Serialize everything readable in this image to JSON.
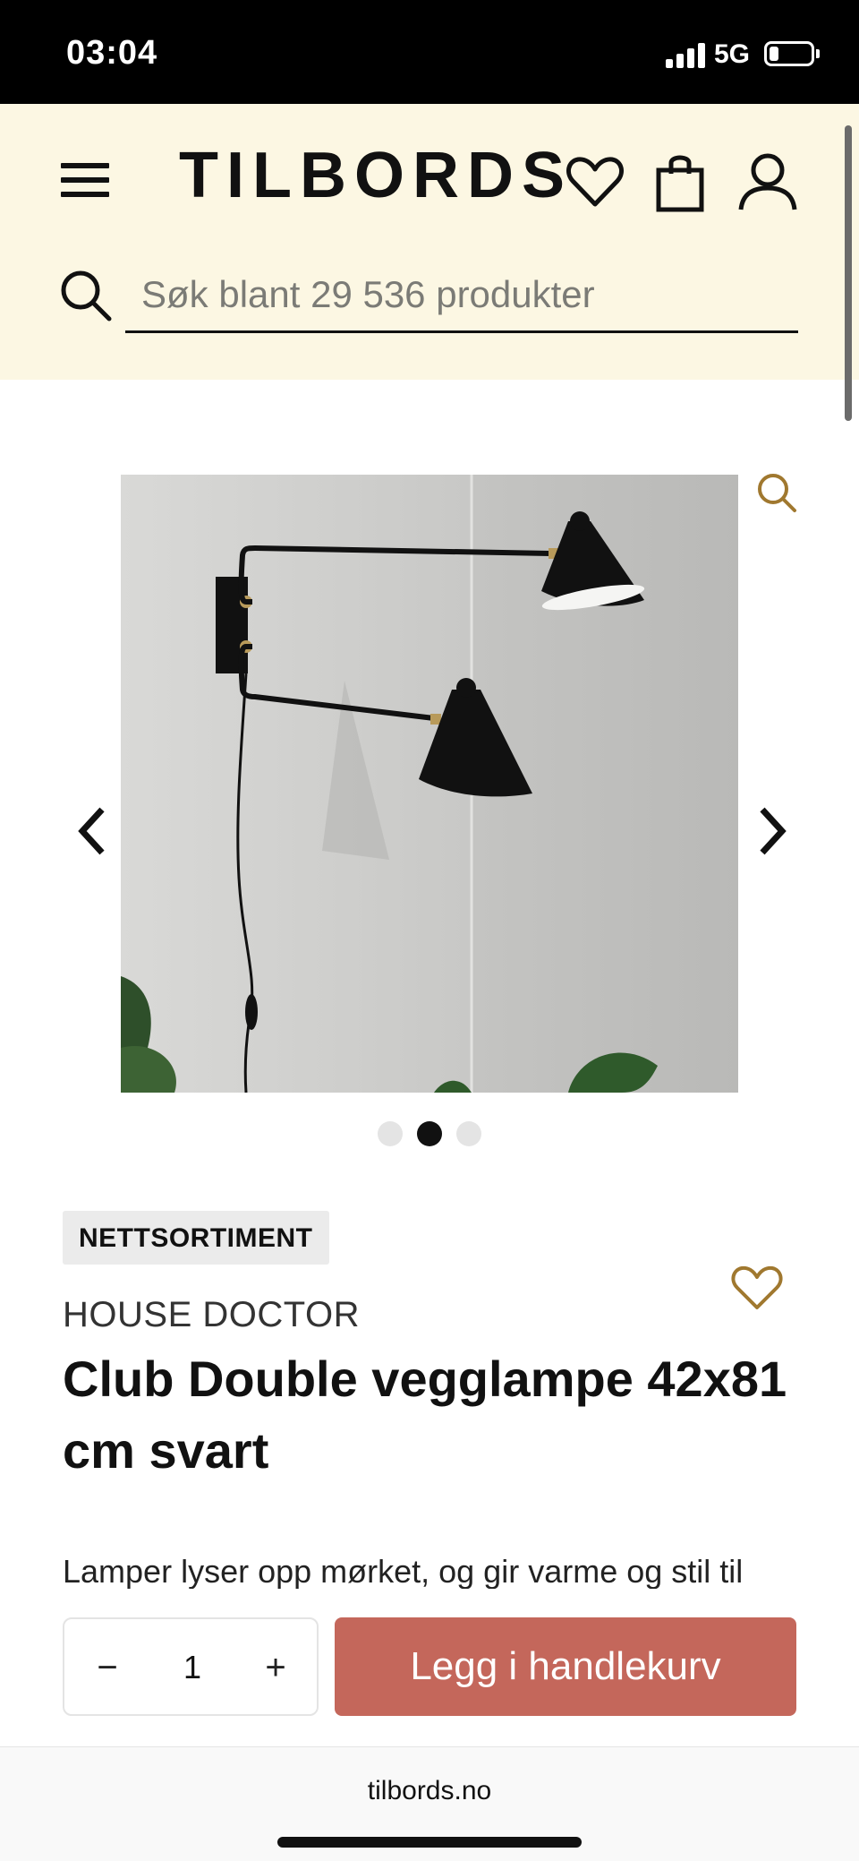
{
  "status_bar": {
    "time": "03:04",
    "network": "5G",
    "battery_level": 0.2
  },
  "header": {
    "logo_text": "TILBORDS",
    "search_placeholder": "Søk blant 29 536 produkter",
    "icons": [
      "menu-icon",
      "heart-icon",
      "shopping-bag-icon",
      "user-icon",
      "search-icon"
    ]
  },
  "gallery": {
    "image_description_icon": "wall-lamp-photo",
    "slide_count": 3,
    "active_slide": 2,
    "icons": [
      "zoom-icon",
      "chevron-left-icon",
      "chevron-right-icon"
    ]
  },
  "product": {
    "badge": "NETTSORTIMENT",
    "brand": "HOUSE DOCTOR",
    "title": "Club Double vegglampe 42x81 cm svart",
    "description": "Lamper lyser opp mørket, og gir varme og stil til"
  },
  "cart": {
    "minus": "−",
    "plus": "+",
    "quantity": "1",
    "add_to_cart_label": "Legg i handlekurv"
  },
  "browser": {
    "url": "tilbords.no"
  },
  "colors": {
    "header_bg": "#fcf7e3",
    "accent_gold": "#a0782f",
    "cta": "#c4675b"
  }
}
